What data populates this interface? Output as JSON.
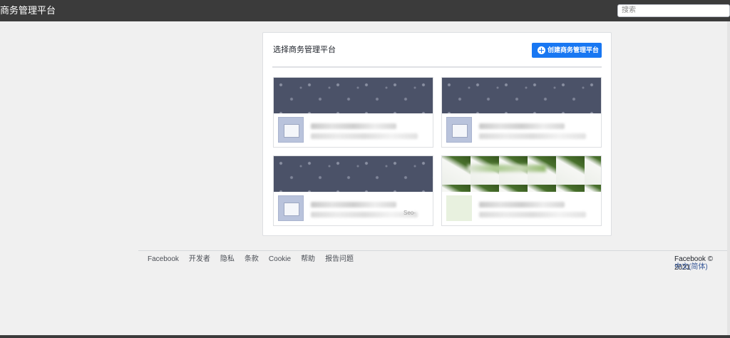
{
  "header": {
    "title": "商务管理平台",
    "search_placeholder": "搜索"
  },
  "main": {
    "title": "选择商务管理平台",
    "create_button_label": "创建商务管理平台",
    "businesses": [
      {
        "cover": "pattern",
        "suffix": ""
      },
      {
        "cover": "pattern",
        "suffix": ""
      },
      {
        "cover": "pattern",
        "suffix": "Seo-"
      },
      {
        "cover": "green",
        "suffix": ""
      }
    ]
  },
  "footer": {
    "links": [
      "Facebook",
      "开发者",
      "隐私",
      "条款",
      "Cookie",
      "帮助",
      "报告问题"
    ],
    "copyright": "Facebook © 2021",
    "language": "中文(简体)"
  },
  "colors": {
    "topbar": "#3b3b3b",
    "accent": "#1877f2",
    "cover": "#4b5268"
  }
}
